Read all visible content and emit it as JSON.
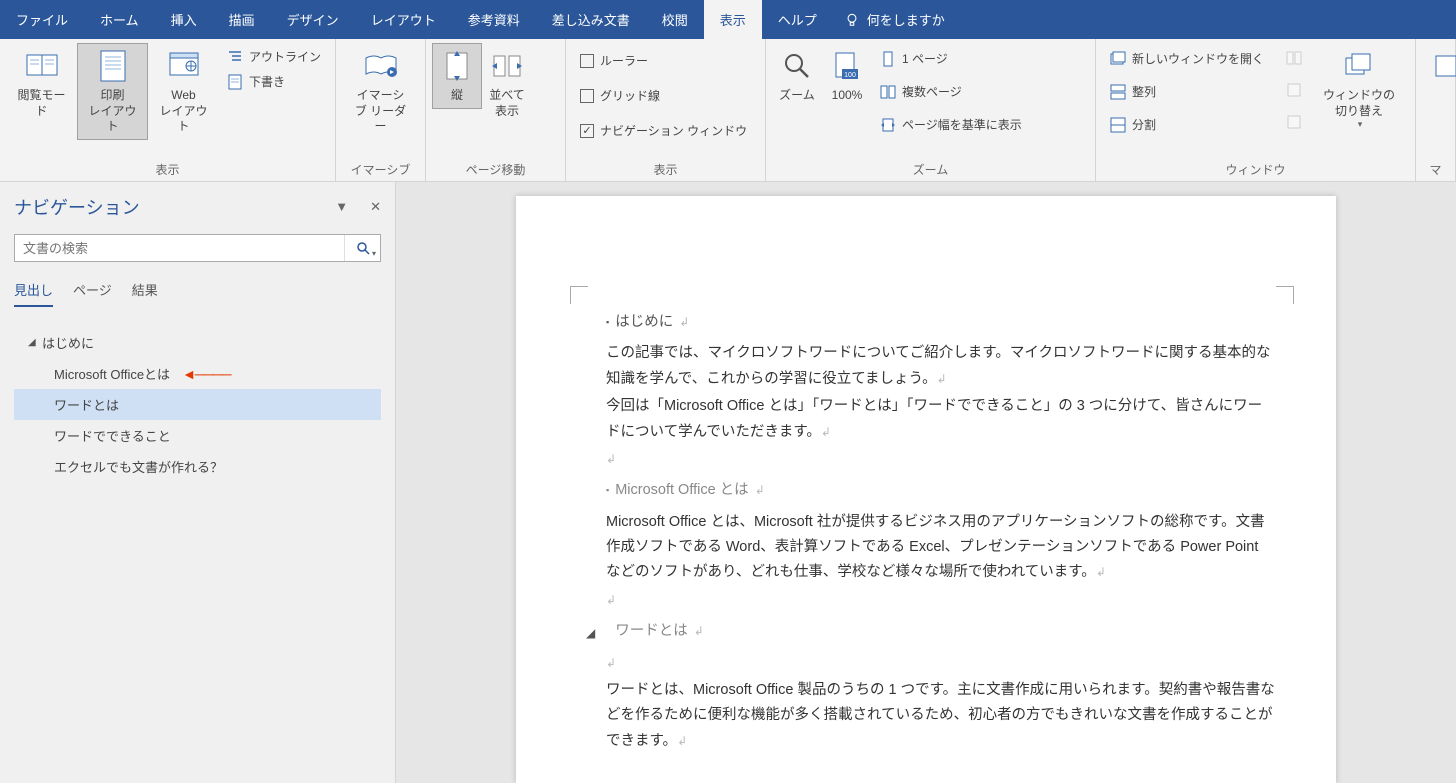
{
  "menu": {
    "items": [
      "ファイル",
      "ホーム",
      "挿入",
      "描画",
      "デザイン",
      "レイアウト",
      "参考資料",
      "差し込み文書",
      "校閲",
      "表示",
      "ヘルプ"
    ],
    "active_index": 9,
    "tell_me": "何をしますか"
  },
  "ribbon": {
    "groups": {
      "views": {
        "label": "表示",
        "read_mode": "閲覧モード",
        "print_layout": "印刷\nレイアウト",
        "web_layout": "Web\nレイアウト",
        "outline": "アウトライン",
        "draft": "下書き"
      },
      "immersive": {
        "label": "イマーシブ",
        "reader": "イマーシ\nブ リーダー"
      },
      "page_move": {
        "label": "ページ移動",
        "vertical": "縦",
        "side": "並べて\n表示"
      },
      "show": {
        "label": "表示",
        "ruler": "ルーラー",
        "grid": "グリッド線",
        "nav": "ナビゲーション ウィンドウ",
        "nav_checked": true
      },
      "zoom": {
        "label": "ズーム",
        "zoom": "ズーム",
        "hundred": "100%",
        "one_page": "1 ページ",
        "multi_page": "複数ページ",
        "page_width": "ページ幅を基準に表示"
      },
      "window": {
        "label": "ウィンドウ",
        "new_window": "新しいウィンドウを開く",
        "arrange": "整列",
        "split": "分割",
        "switch": "ウィンドウの\n切り替え"
      },
      "macros": {
        "label": "マ"
      }
    }
  },
  "nav": {
    "title": "ナビゲーション",
    "search_placeholder": "文書の検索",
    "tabs": {
      "headings": "見出し",
      "pages": "ページ",
      "results": "結果"
    },
    "active_tab": 0,
    "outline": [
      {
        "level": 1,
        "label": "はじめに",
        "expanded": true
      },
      {
        "level": 2,
        "label": "Microsoft Officeとは",
        "annotated": true
      },
      {
        "level": 2,
        "label": "ワードとは",
        "selected": true
      },
      {
        "level": 2,
        "label": "ワードでできること"
      },
      {
        "level": 2,
        "label": "エクセルでも文書が作れる？"
      }
    ]
  },
  "document": {
    "h1": "はじめに",
    "p1": "この記事では、マイクロソフトワードについてご紹介します。マイクロソフトワードに関する基本的な知識を学んで、これからの学習に役立てましょう。",
    "p2": "今回は「Microsoft Office とは」「ワードとは」「ワードでできること」の 3 つに分けて、皆さんにワードについて学んでいただきます。",
    "h2a": "Microsoft Office とは",
    "p3": "Microsoft Office とは、Microsoft 社が提供するビジネス用のアプリケーションソフトの総称です。文書作成ソフトである Word、表計算ソフトである Excel、プレゼンテーションソフトである Power Point などのソフトがあり、どれも仕事、学校など様々な場所で使われています。",
    "h2b": "ワードとは",
    "p4": "ワードとは、Microsoft Office 製品のうちの 1 つです。主に文書作成に用いられます。契約書や報告書などを作るために便利な機能が多く搭載されているため、初心者の方でもきれいな文書を作成することができます。"
  }
}
